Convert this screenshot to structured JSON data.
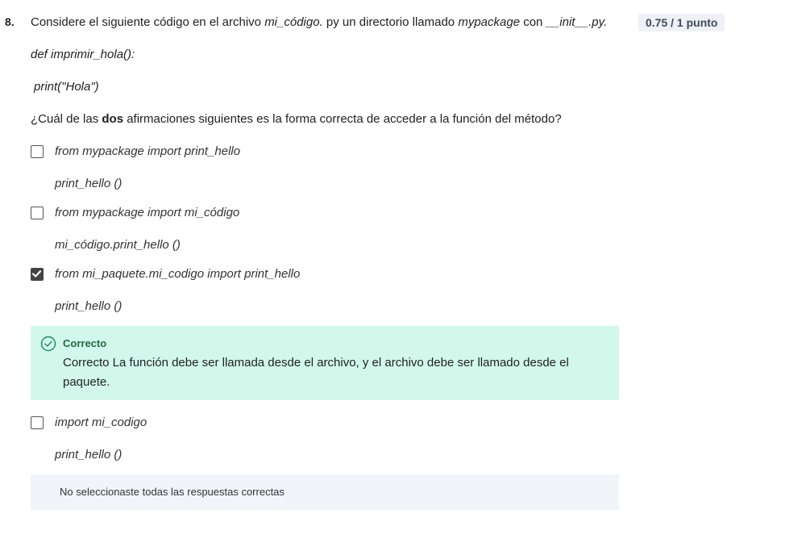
{
  "question": {
    "number": "8.",
    "text_parts": {
      "p1": "Considere el siguiente código en el archivo ",
      "file_name": "mi_código.",
      "p2": " py un directorio llamado ",
      "dir_name": "mypackage",
      "p3": " con ",
      "init_file": "__init__.py.",
      "p4": ""
    },
    "points": "0.75 / 1 punto",
    "code_line_1": "def imprimir_hola():",
    "code_line_2": "print(\"Hola\")",
    "prompt_parts": {
      "before": "¿Cuál de las ",
      "bold": "dos",
      "after": " afirmaciones siguientes es la forma correcta de acceder a la función del método?"
    }
  },
  "options": [
    {
      "line1": "from mypackage import print_hello",
      "line2": "print_hello ()",
      "checked": false
    },
    {
      "line1": "from mypackage import mi_código",
      "line2": "mi_código.print_hello ()",
      "checked": false
    },
    {
      "line1": "from mi_paquete.mi_codigo import print_hello",
      "line2": "print_hello ()",
      "checked": true
    },
    {
      "line1": "import mi_codigo",
      "line2": "print_hello ()",
      "checked": false
    }
  ],
  "feedback_correct": {
    "title": "Correcto",
    "text": "Correcto La función debe ser llamada desde el archivo, y el archivo debe ser llamado desde el paquete.",
    "icon": "check-circle-icon",
    "color": "#d2f8ec"
  },
  "feedback_incomplete": {
    "text": "No seleccionaste todas las respuestas correctas",
    "color": "#f1f4f9"
  }
}
